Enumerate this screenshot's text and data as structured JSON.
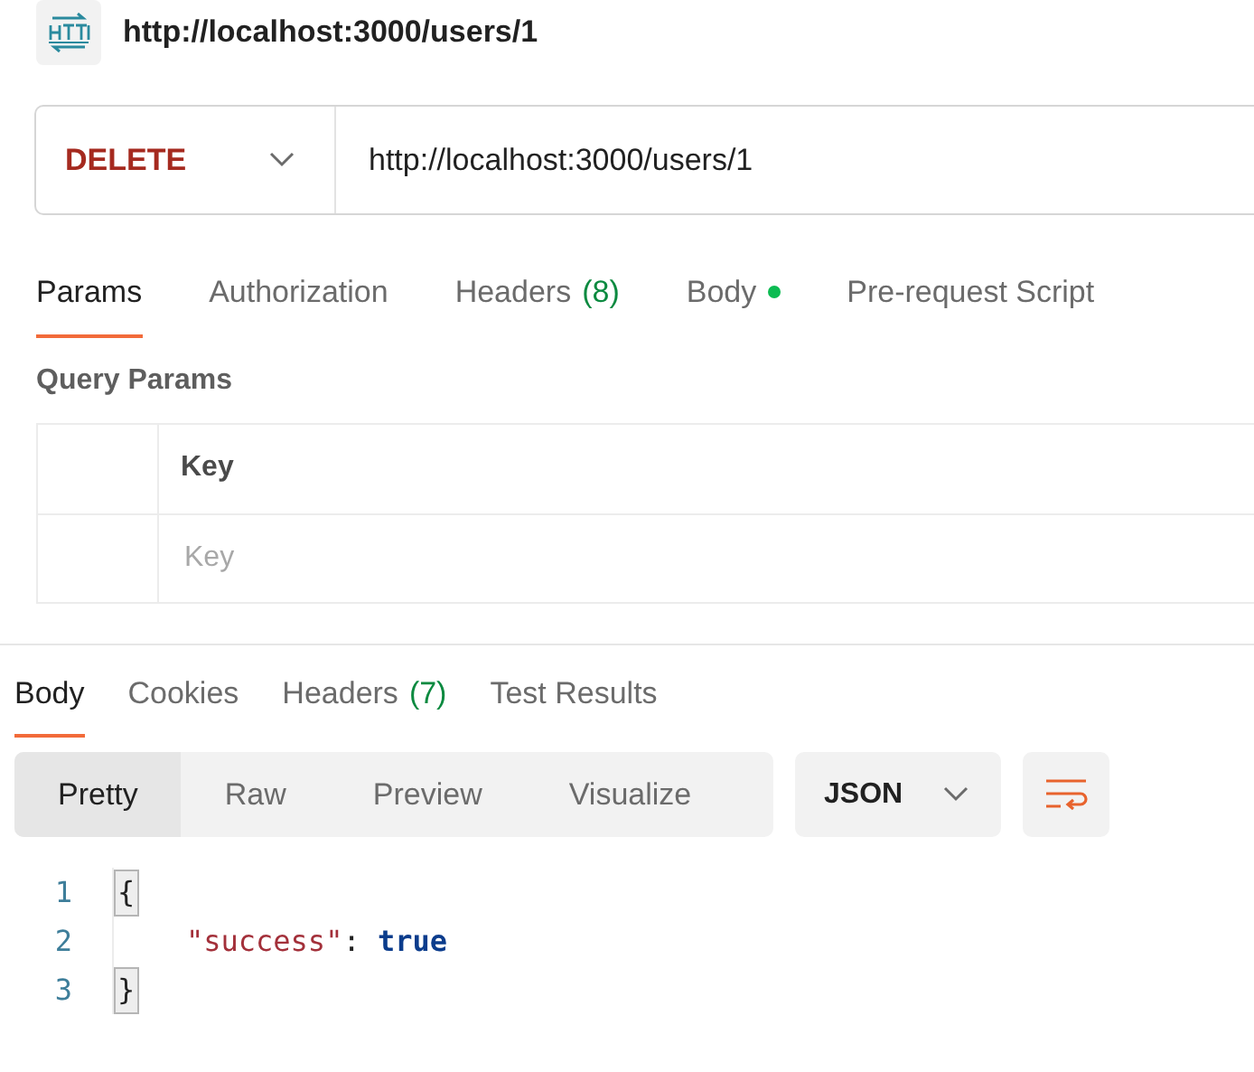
{
  "request": {
    "title": "http://localhost:3000/users/1",
    "method": "DELETE",
    "url": "http://localhost:3000/users/1"
  },
  "request_tabs": [
    {
      "label": "Params",
      "selected": true,
      "modified": false
    },
    {
      "label": "Authorization",
      "selected": false,
      "modified": false
    },
    {
      "label": "Headers",
      "count": "(8)",
      "selected": false,
      "modified": false
    },
    {
      "label": "Body",
      "selected": false,
      "modified": true
    },
    {
      "label": "Pre-request Script",
      "selected": false,
      "modified": false
    }
  ],
  "query_params": {
    "heading": "Query Params",
    "columns": [
      "Key"
    ],
    "new_row": {
      "placeholder": "Key"
    }
  },
  "response_tabs": [
    {
      "label": "Body",
      "selected": true
    },
    {
      "label": "Cookies",
      "selected": false
    },
    {
      "label": "Headers",
      "count": "(7)",
      "selected": false
    },
    {
      "label": "Test Results",
      "selected": false
    }
  ],
  "view_modes": [
    {
      "label": "Pretty",
      "selected": true
    },
    {
      "label": "Raw",
      "selected": false
    },
    {
      "label": "Preview",
      "selected": false
    },
    {
      "label": "Visualize",
      "selected": false
    }
  ],
  "format": "JSON",
  "code_lines": [
    {
      "number": "1",
      "indented": false,
      "tokens": [
        {
          "kind": "matched-brace",
          "text": "{"
        }
      ]
    },
    {
      "number": "2",
      "indented": true,
      "tokens": [
        {
          "kind": "string",
          "text": "\"success\""
        },
        {
          "kind": "punct",
          "text": ": "
        },
        {
          "kind": "keyword",
          "text": "true"
        }
      ]
    },
    {
      "number": "3",
      "indented": false,
      "tokens": [
        {
          "kind": "matched-brace",
          "text": "}"
        }
      ]
    }
  ]
}
